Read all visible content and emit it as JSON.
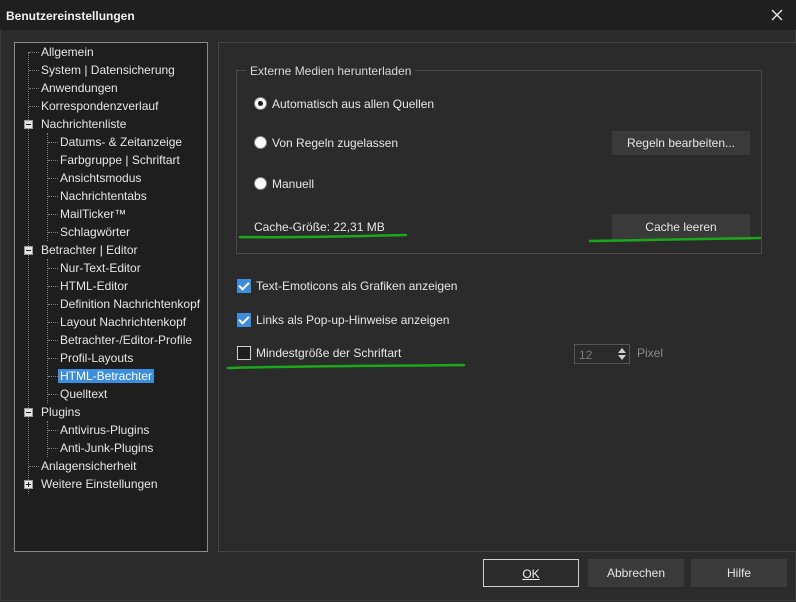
{
  "window": {
    "title": "Benutzereinstellungen"
  },
  "tree": {
    "items": [
      {
        "label": "Allgemein"
      },
      {
        "label": "System | Datensicherung"
      },
      {
        "label": "Anwendungen"
      },
      {
        "label": "Korrespondenzverlauf"
      },
      {
        "label": "Nachrichtenliste"
      },
      {
        "label": "Datums- & Zeitanzeige"
      },
      {
        "label": "Farbgruppe | Schriftart"
      },
      {
        "label": "Ansichtsmodus"
      },
      {
        "label": "Nachrichtentabs"
      },
      {
        "label": "MailTicker™"
      },
      {
        "label": "Schlagwörter"
      },
      {
        "label": "Betrachter | Editor"
      },
      {
        "label": "Nur-Text-Editor"
      },
      {
        "label": "HTML-Editor"
      },
      {
        "label": "Definition Nachrichtenkopf"
      },
      {
        "label": "Layout Nachrichtenkopf"
      },
      {
        "label": "Betrachter-/Editor-Profile"
      },
      {
        "label": "Profil-Layouts"
      },
      {
        "label": "HTML-Betrachter"
      },
      {
        "label": "Quelltext"
      },
      {
        "label": "Plugins"
      },
      {
        "label": "Antivirus-Plugins"
      },
      {
        "label": "Anti-Junk-Plugins"
      },
      {
        "label": "Anlagensicherheit"
      },
      {
        "label": "Weitere Einstellungen"
      }
    ],
    "selected": "HTML-Betrachter"
  },
  "external_media": {
    "group_title": "Externe Medien herunterladen",
    "options": [
      {
        "label": "Automatisch aus allen Quellen",
        "checked": true
      },
      {
        "label": "Von Regeln zugelassen",
        "checked": false
      },
      {
        "label": "Manuell",
        "checked": false
      }
    ],
    "rules_button": "Regeln bearbeiten...",
    "cache_size": "Cache-Größe: 22,31 MB",
    "clear_cache_button": "Cache leeren"
  },
  "checkboxes": [
    {
      "label": "Text-Emoticons als Grafiken anzeigen",
      "checked": true
    },
    {
      "label": "Links als Pop-up-Hinweise anzeigen",
      "checked": true
    },
    {
      "label": "Mindestgröße der Schriftart",
      "checked": false
    }
  ],
  "min_font": {
    "value": "12",
    "unit": "Pixel"
  },
  "footer": {
    "ok": "OK",
    "cancel": "Abbrechen",
    "help": "Hilfe"
  },
  "colors": {
    "accent": "#3c8ddb",
    "annotation": "#1aa81a",
    "background": "#2b2b2b"
  }
}
